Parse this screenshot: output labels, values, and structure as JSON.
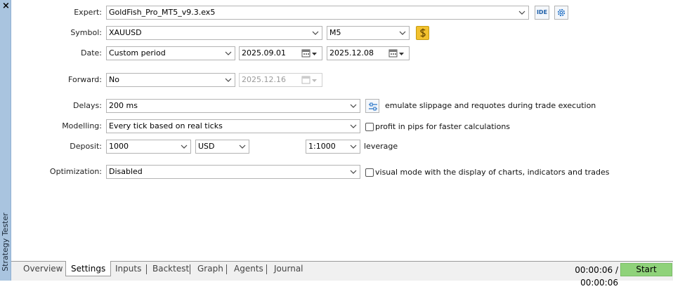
{
  "panel": {
    "close_glyph": "×",
    "title": "Strategy Tester"
  },
  "labels": {
    "expert": "Expert:",
    "symbol": "Symbol:",
    "date": "Date:",
    "forward": "Forward:",
    "delays": "Delays:",
    "modelling": "Modelling:",
    "deposit": "Deposit:",
    "optimization": "Optimization:"
  },
  "expert": {
    "value": "GoldFish_Pro_MT5_v9.3.ex5",
    "ide_label": "IDE"
  },
  "symbol": {
    "value": "XAUUSD",
    "timeframe": "M5",
    "spec_icon": "dollar"
  },
  "date": {
    "mode": "Custom period",
    "from": "2025.09.01",
    "to": "2025.12.08"
  },
  "forward": {
    "value": "No",
    "date": "2025.12.16"
  },
  "delays": {
    "value": "200 ms",
    "option_text": "emulate slippage and requotes during trade execution"
  },
  "modelling": {
    "value": "Every tick based on real ticks",
    "option_text": "profit in pips for faster calculations",
    "option_checked": false
  },
  "deposit": {
    "amount": "1000",
    "currency": "USD",
    "leverage": "1:1000",
    "leverage_label": "leverage"
  },
  "optimization": {
    "value": "Disabled",
    "option_text": "visual mode with the display of charts, indicators and trades",
    "option_checked": false
  },
  "tabs": [
    {
      "label": "Overview",
      "active": false
    },
    {
      "label": "Settings",
      "active": true
    },
    {
      "label": "Inputs",
      "active": false
    },
    {
      "label": "Backtest",
      "active": false
    },
    {
      "label": "Graph",
      "active": false
    },
    {
      "label": "Agents",
      "active": false
    },
    {
      "label": "Journal",
      "active": false
    }
  ],
  "status": {
    "timer": "00:00:06 / 00:00:06",
    "start_label": "Start"
  },
  "colors": {
    "side_strip": "#a9c4df",
    "start_button": "#8fd27a",
    "gold_icon": "#f2c12e"
  }
}
